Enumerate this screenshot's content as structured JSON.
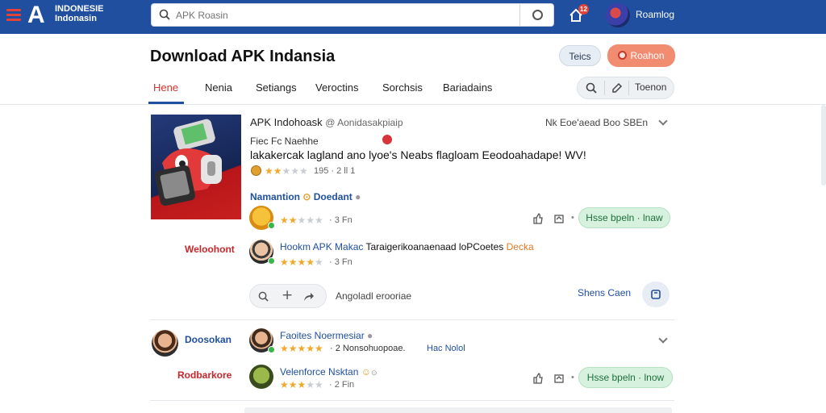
{
  "header": {
    "logo_text": "INDONESIE Indonasin",
    "search_placeholder": "APK Roasin",
    "notification_count": "12",
    "username": "Roamlog"
  },
  "page": {
    "title": "Download APK Indansia",
    "btn_tests": "Teics",
    "btn_reason": "Roahon"
  },
  "tabs": [
    {
      "label": "Hene",
      "active": true
    },
    {
      "label": "Nenia"
    },
    {
      "label": "Setiangs"
    },
    {
      "label": "Veroctins"
    },
    {
      "label": "Sorchsis"
    },
    {
      "label": "Bariadains"
    }
  ],
  "toolbar": {
    "label": "Toenon"
  },
  "post": {
    "author": "APK Indohoask",
    "handle": "@ Aonidasakpiaip",
    "right_meta": "Nk Eoe'aead Boo SBEn",
    "subtitle": "Fiec Fc Naehhe",
    "body": "lakakercak lagland ano lyoe's Neabs flagloam Eeodoahadape! WV!",
    "rating": {
      "filled": 2,
      "total": 5
    },
    "meta": "195 · 2 ll 1"
  },
  "comments_section": {
    "label": "Namantion",
    "label_suffix": "Doedant"
  },
  "comments": [
    {
      "name": "",
      "rating": {
        "filled": 2,
        "total": 5
      },
      "meta": "· 3 Fn",
      "reply_label": "Hsse bpeln · lnaw"
    },
    {
      "side_label": "Weloohont",
      "name": "Hookm APK Makac",
      "text": "Taraigerikoanaenaad loPCoetes",
      "highlight": "Decka",
      "rating": {
        "filled": 4,
        "total": 5
      },
      "meta": "· 3 Fn"
    }
  ],
  "actions": {
    "text": "Angoladl erooriae",
    "share_link": "Shens Caen"
  },
  "thread2": {
    "side_name": "Doosokan",
    "name": "Faoites Noermesiar",
    "rating": {
      "filled": 5,
      "total": 5
    },
    "meta": "· 2 Nonsohuopoae.",
    "tag": "Hac Nolol"
  },
  "thread3": {
    "side_name": "Rodbarkore",
    "name": "Velenforce Nsktan",
    "rating": {
      "filled": 3,
      "total": 5
    },
    "meta": "· 2 Fin",
    "reply_label": "Hsse bpeln · lnow"
  }
}
